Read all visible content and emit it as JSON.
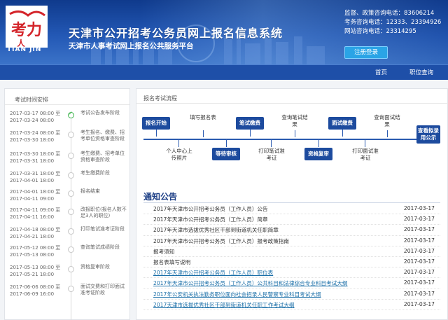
{
  "header": {
    "logo_text_cn": "人考力",
    "logo_text": "TIAN JIN",
    "title": "天津市公开招考公务员网上报名信息系统",
    "subtitle": "天津市人事考试网上报名公共服务平台",
    "contacts": [
      {
        "label": "监督、政策咨询电话：",
        "value": "83606214"
      },
      {
        "label": "考务咨询电话：",
        "value": "12333、23394926"
      },
      {
        "label": "网站咨询电话：",
        "value": "23314295"
      }
    ],
    "login_label": "注册登录"
  },
  "nav": {
    "home": "首页",
    "position_search": "职位查询"
  },
  "timeline": {
    "title": "考试时间安排",
    "items": [
      {
        "date_start": "2017-03-17 08:00 至",
        "date_end": "2017-03-24 08:00",
        "label": "考试公告发布阶段",
        "done": true
      },
      {
        "date_start": "2017-03-24 08:00 至",
        "date_end": "2017-03-30 18:00",
        "label": "考生报名、缴费、招考单位资格审查阶段",
        "done": false
      },
      {
        "date_start": "2017-03-30 18:00 至",
        "date_end": "2017-03-31 18:00",
        "label": "考生缴费、招考单位资格审查阶段",
        "done": false
      },
      {
        "date_start": "2017-03-31 18:00 至",
        "date_end": "2017-04-01 18:00",
        "label": "考生缴费阶段",
        "done": false
      },
      {
        "date_start": "2017-04-01 18:00 至",
        "date_end": "2017-04-11 09:00",
        "label": "报名结束",
        "done": false
      },
      {
        "date_start": "2017-04-11 09:00 至",
        "date_end": "2017-04-11 16:00",
        "label": "改报职位(报名人数不足3人的职位)",
        "done": false
      },
      {
        "date_start": "2017-04-18 08:00 至",
        "date_end": "2017-04-21 18:00",
        "label": "打印笔试准考证阶段",
        "done": false
      },
      {
        "date_start": "2017-05-12 08:00 至",
        "date_end": "2017-05-13 08:00",
        "label": "查询笔试成绩阶段",
        "done": false
      },
      {
        "date_start": "2017-05-13 08:00 至",
        "date_end": "2017-05-21 18:00",
        "label": "资格复审阶段",
        "done": false
      },
      {
        "date_start": "2017-06-06 08:00 至",
        "date_end": "2017-06-09 16:00",
        "label": "面试交费和打印面试准考证阶段",
        "done": false
      }
    ]
  },
  "flow": {
    "title": "报名考试流程",
    "steps": {
      "start": "报名开始",
      "fill_form": "填写报名表",
      "upload_photo": "个人中心上传照片",
      "wait_review": "等待审核",
      "written_fee": "笔试缴费",
      "print_written": "打印笔试准考证",
      "query_written": "查询笔试结果",
      "requalify": "资格复审",
      "interview_fee": "面试缴费",
      "print_interview": "打印面试准考证",
      "query_interview": "查询面试结果",
      "view_hire": "查看拟录用公示"
    }
  },
  "notices": {
    "title": "通知公告",
    "items": [
      {
        "title": "2017年天津市公开招考公务员（工作人员）公告",
        "date": "2017-03-17",
        "link": false
      },
      {
        "title": "2017年天津市公开招考公务员（工作人员）简章",
        "date": "2017-03-17",
        "link": false
      },
      {
        "title": "2017年天津市选拔优秀社区干部到街道机关任职简章",
        "date": "2017-03-17",
        "link": false
      },
      {
        "title": "2017年天津市公开招考公务员（工作人员）报考政策指南",
        "date": "2017-03-17",
        "link": false
      },
      {
        "title": "报考须知",
        "date": "2017-03-17",
        "link": false
      },
      {
        "title": "报名表填写说明",
        "date": "2017-03-17",
        "link": false
      },
      {
        "title": "2017年天津市公开招考公务员（工作人员）职位表",
        "date": "2017-03-17",
        "link": true
      },
      {
        "title": "2017年天津市公开招考公务员（工作人员）公共科目和法律综合专业科目考试大纲",
        "date": "2017-03-17",
        "link": true
      },
      {
        "title": "2017年公安机关执法勤务职位面向社会招录人民警察专业科目考试大纲",
        "date": "2017-03-17",
        "link": true
      },
      {
        "title": "2017天津市选拔优秀社区干部到街道机关任职工作考试大纲",
        "date": "2017-03-17",
        "link": true
      }
    ]
  }
}
